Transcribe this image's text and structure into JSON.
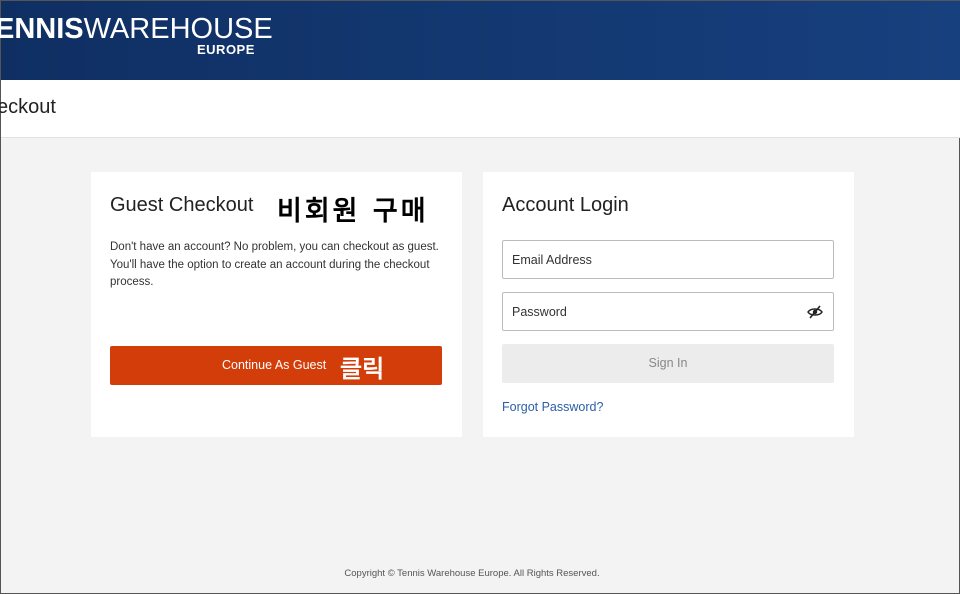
{
  "header": {
    "logo_bold": "ENNIS",
    "logo_light": "WAREHOUSE",
    "logo_sub": "EUROPE"
  },
  "page": {
    "title": "eckout"
  },
  "guest": {
    "title": "Guest Checkout",
    "annotation": "비회원 구매",
    "description": "Don't have an account? No problem, you can checkout as guest. You'll have the option to create an account during the checkout process.",
    "button_label": "Continue As Guest",
    "button_annotation": "클릭",
    "button_color": "#d33d0a"
  },
  "login": {
    "title": "Account Login",
    "email_placeholder": "Email Address",
    "password_placeholder": "Password",
    "password_toggle_icon": "eye-slash-icon",
    "signin_label": "Sign In",
    "forgot_label": "Forgot Password?",
    "link_color": "#2a5fa8"
  },
  "footer": {
    "copyright": "Copyright © Tennis Warehouse Europe. All Rights Reserved."
  }
}
